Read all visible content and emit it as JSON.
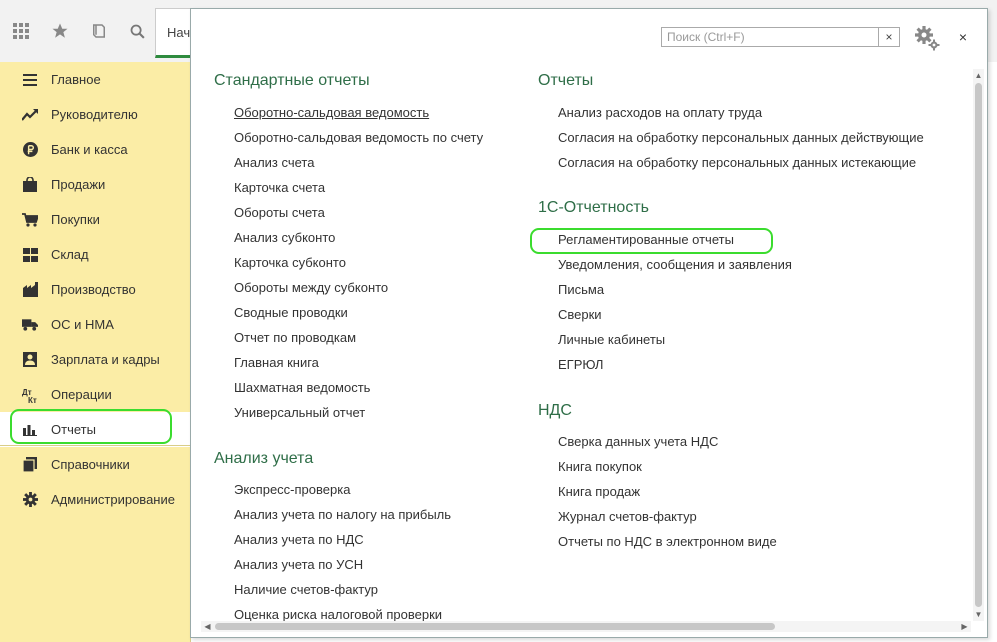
{
  "header": {
    "icons": [
      "apps-grid-icon",
      "star-icon",
      "history-icon",
      "search-icon"
    ],
    "home_tab_label": "Начальная страница"
  },
  "sidebar": {
    "items": [
      {
        "label": "Главное",
        "icon": "menu-lines-icon"
      },
      {
        "label": "Руководителю",
        "icon": "trend-chart-icon"
      },
      {
        "label": "Банк и касса",
        "icon": "ruble-coin-icon"
      },
      {
        "label": "Продажи",
        "icon": "shopping-bag-icon"
      },
      {
        "label": "Покупки",
        "icon": "shopping-cart-icon"
      },
      {
        "label": "Склад",
        "icon": "warehouse-icon"
      },
      {
        "label": "Производство",
        "icon": "factory-icon"
      },
      {
        "label": "ОС и НМА",
        "icon": "truck-icon"
      },
      {
        "label": "Зарплата и кадры",
        "icon": "person-icon"
      },
      {
        "label": "Операции",
        "icon": "debit-credit-icon"
      },
      {
        "label": "Отчеты",
        "icon": "bar-chart-icon"
      },
      {
        "label": "Справочники",
        "icon": "books-icon"
      },
      {
        "label": "Администрирование",
        "icon": "gear-icon"
      }
    ],
    "active": "Отчеты",
    "highlight_color": "#3bdc2e",
    "background_color": "#fbeda6"
  },
  "panel": {
    "search_placeholder": "Поиск (Ctrl+F)",
    "search_value": "",
    "clear_label": "×",
    "close_label": "×",
    "title_color": "#2f6e48",
    "sections_left": [
      {
        "title": "Стандартные отчеты",
        "items": [
          "Оборотно-сальдовая ведомость",
          "Оборотно-сальдовая ведомость по счету",
          "Анализ счета",
          "Карточка счета",
          "Обороты счета",
          "Анализ субконто",
          "Карточка субконто",
          "Обороты между субконто",
          "Сводные проводки",
          "Отчет по проводкам",
          "Главная книга",
          "Шахматная ведомость",
          "Универсальный отчет"
        ]
      },
      {
        "title": "Анализ учета",
        "items": [
          "Экспресс-проверка",
          "Анализ учета по налогу на прибыль",
          "Анализ учета по НДС",
          "Анализ учета по УСН",
          "Наличие счетов-фактур",
          "Оценка риска налоговой проверки"
        ]
      }
    ],
    "sections_right": [
      {
        "title": "Отчеты",
        "items": [
          "Анализ расходов на оплату труда",
          "Согласия на обработку персональных данных действующие",
          "Согласия на обработку персональных данных истекающие"
        ]
      },
      {
        "title": "1С-Отчетность",
        "items": [
          "Регламентированные отчеты",
          "Уведомления, сообщения и заявления",
          "Письма",
          "Сверки",
          "Личные кабинеты",
          "ЕГРЮЛ"
        ]
      },
      {
        "title": "НДС",
        "items": [
          "Сверка данных учета НДС",
          "Книга покупок",
          "Книга продаж",
          "Журнал счетов-фактур",
          "Отчеты по НДС в электронном виде"
        ]
      }
    ]
  }
}
